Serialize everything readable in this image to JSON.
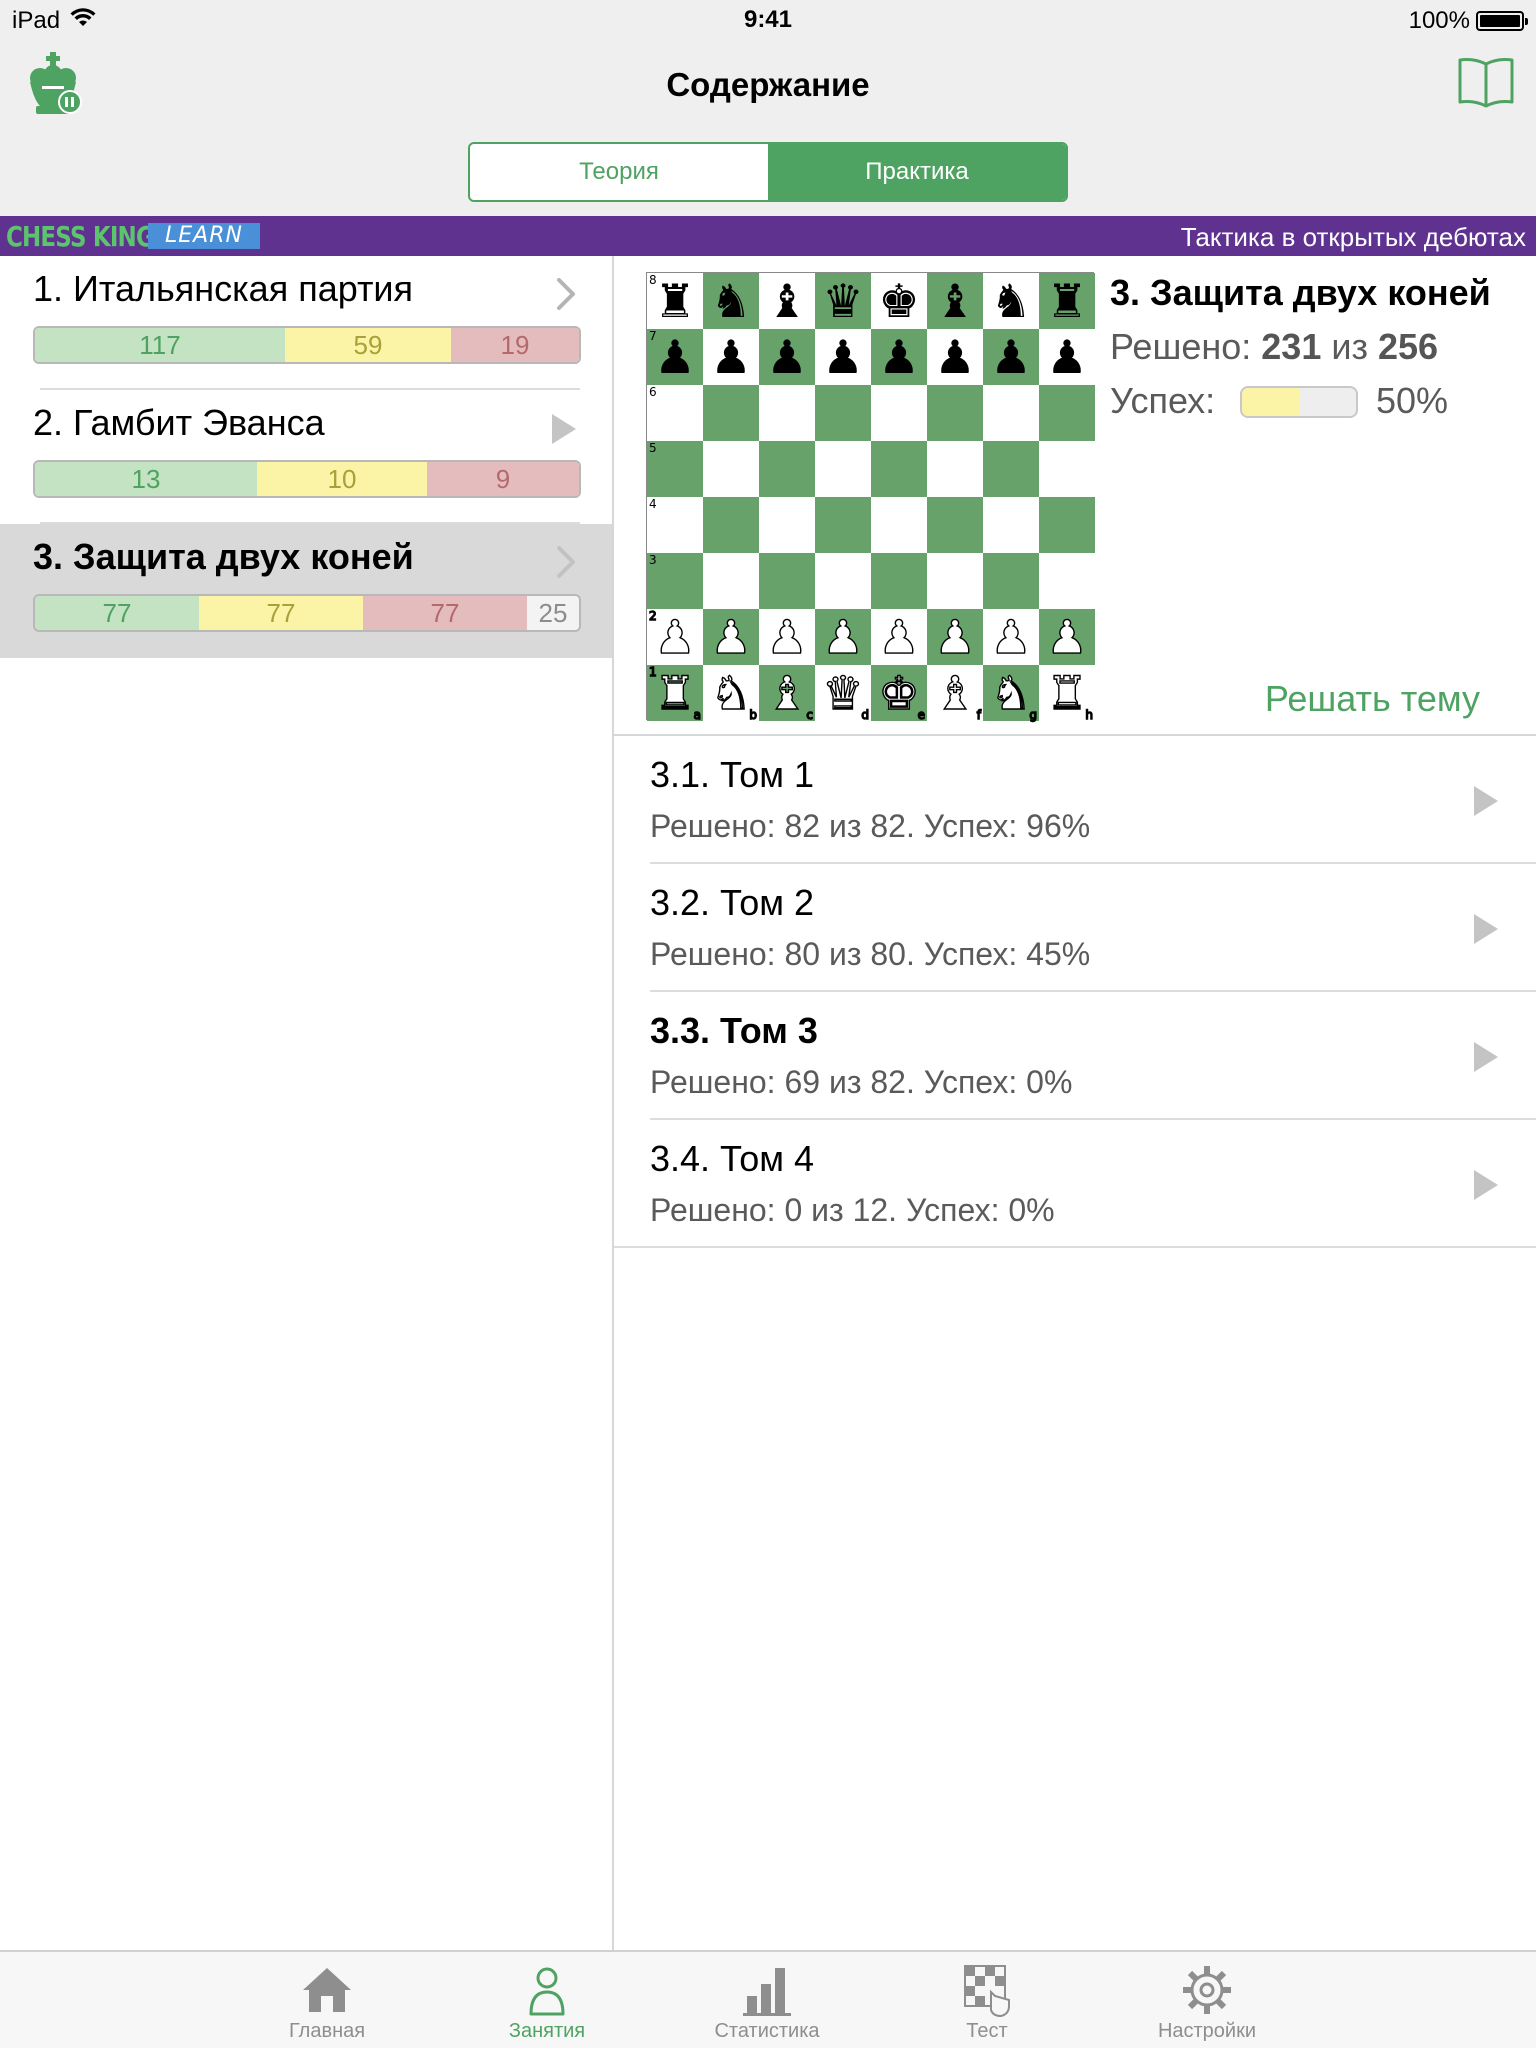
{
  "status": {
    "carrier": "iPad",
    "time": "9:41",
    "battery": "100%"
  },
  "nav": {
    "title": "Содержание",
    "segments": [
      {
        "label": "Теория",
        "active": false
      },
      {
        "label": "Практика",
        "active": true
      }
    ]
  },
  "banner": {
    "brand": "CHESS KING",
    "badge": "LEARN",
    "course_title": "Тактика в открытых дебютах"
  },
  "colors": {
    "accent": "#4fa362",
    "banner": "#5f3290",
    "green": "#c3e3c2",
    "yellow": "#fbf4a6",
    "red": "#e5bcbe"
  },
  "chapters": [
    {
      "title": "1. Итальянская партия",
      "icon": "chevron-right-icon",
      "selected": false,
      "stats": {
        "green": "117",
        "yellow": "59",
        "red": "19",
        "grey": null
      }
    },
    {
      "title": "2. Гамбит Эванса",
      "icon": "play-icon",
      "selected": false,
      "stats": {
        "green": "13",
        "yellow": "10",
        "red": "9",
        "grey": null
      }
    },
    {
      "title": "3. Защита двух коней",
      "icon": "chevron-right-icon",
      "selected": true,
      "stats": {
        "green": "77",
        "yellow": "77",
        "red": "77",
        "grey": "25"
      }
    }
  ],
  "detail": {
    "title": "3. Защита двух коней",
    "solved_label": "Решено:",
    "solved_count": "231",
    "of_label": "из",
    "total": "256",
    "success_label": "Успех:",
    "success_fraction": 0.5,
    "success_pct": "50%",
    "solve_button": "Решать тему"
  },
  "board": {
    "rank_labels": [
      "8",
      "7",
      "6",
      "5",
      "4",
      "3",
      "2",
      "1"
    ],
    "file_labels": [
      "a",
      "b",
      "c",
      "d",
      "e",
      "f",
      "g",
      "h"
    ],
    "position": [
      [
        "r",
        "n",
        "b",
        "q",
        "k",
        "b",
        "n",
        "r"
      ],
      [
        "p",
        "p",
        "p",
        "p",
        "p",
        "p",
        "p",
        "p"
      ],
      [
        "",
        "",
        "",
        "",
        "",
        "",
        "",
        ""
      ],
      [
        "",
        "",
        "",
        "",
        "",
        "",
        "",
        ""
      ],
      [
        "",
        "",
        "",
        "",
        "",
        "",
        "",
        ""
      ],
      [
        "",
        "",
        "",
        "",
        "",
        "",
        "",
        ""
      ],
      [
        "P",
        "P",
        "P",
        "P",
        "P",
        "P",
        "P",
        "P"
      ],
      [
        "R",
        "N",
        "B",
        "Q",
        "K",
        "B",
        "N",
        "R"
      ]
    ]
  },
  "volumes": [
    {
      "title": "3.1. Том 1",
      "subtitle": "Решено: 82 из 82. Успех: 96%",
      "bold": false
    },
    {
      "title": "3.2. Том 2",
      "subtitle": "Решено: 80 из 80. Успех: 45%",
      "bold": false
    },
    {
      "title": "3.3. Том 3",
      "subtitle": "Решено: 69 из 82. Успех: 0%",
      "bold": true
    },
    {
      "title": "3.4. Том 4",
      "subtitle": "Решено: 0 из 12. Успех: 0%",
      "bold": false
    }
  ],
  "tabs": [
    {
      "label": "Главная",
      "icon": "home-icon",
      "active": false
    },
    {
      "label": "Занятия",
      "icon": "person-icon",
      "active": true
    },
    {
      "label": "Статистика",
      "icon": "bar-chart-icon",
      "active": false
    },
    {
      "label": "Тест",
      "icon": "test-board-icon",
      "active": false
    },
    {
      "label": "Настройки",
      "icon": "gear-icon",
      "active": false
    }
  ]
}
